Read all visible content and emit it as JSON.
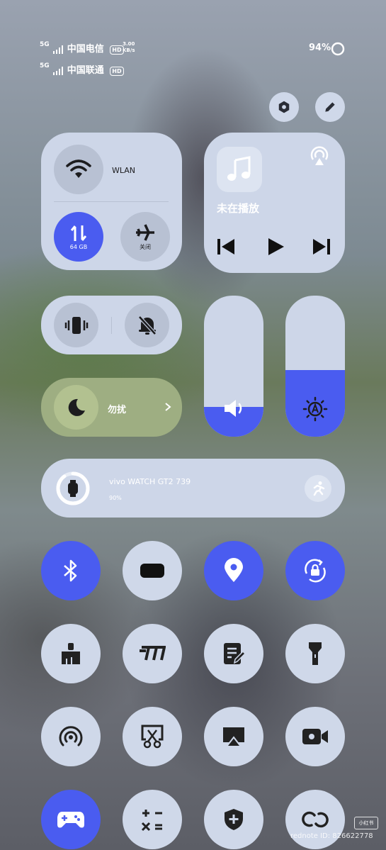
{
  "status_bar": {
    "sim1": {
      "network": "5G",
      "carrier": "中国电信",
      "hd": "HD",
      "speed_value": "3.00",
      "speed_unit": "KB/s"
    },
    "sim2": {
      "network": "5G",
      "carrier": "中国联通",
      "hd": "HD"
    },
    "battery": "94%"
  },
  "connectivity": {
    "wlan_label": "WLAN",
    "mobile_data_label": "64 GB",
    "airplane_label": "关闭"
  },
  "media": {
    "status": "未在播放"
  },
  "dnd": {
    "label": "勿扰"
  },
  "device": {
    "name": "vivo WATCH GT2 739",
    "battery": "90%",
    "battery_level": 0.9
  },
  "sliders": {
    "volume_level": 0.21,
    "brightness_level": 0.47
  },
  "colors": {
    "accent": "#4a5cf0",
    "tile": "#cfd8e9"
  },
  "tiles": [
    {
      "icon": "bluetooth-icon",
      "active": true
    },
    {
      "icon": "rectangle-icon",
      "active": false
    },
    {
      "icon": "location-icon",
      "active": true
    },
    {
      "icon": "rotation-lock-icon",
      "active": true
    },
    {
      "icon": "broom-icon",
      "active": false
    },
    {
      "icon": "m-icon",
      "active": false
    },
    {
      "icon": "note-icon",
      "active": false
    },
    {
      "icon": "flashlight-icon",
      "active": false
    },
    {
      "icon": "hotspot-icon",
      "active": false
    },
    {
      "icon": "screenshot-icon",
      "active": false
    },
    {
      "icon": "screen-cast-icon",
      "active": false
    },
    {
      "icon": "screen-record-icon",
      "active": false
    },
    {
      "icon": "game-icon",
      "active": true
    },
    {
      "icon": "calculator-icon",
      "active": false
    },
    {
      "icon": "security-icon",
      "active": false
    },
    {
      "icon": "link-icon",
      "active": false
    }
  ],
  "watermark": {
    "logo": "小红书",
    "id_text": "rednote ID: 826622778"
  }
}
